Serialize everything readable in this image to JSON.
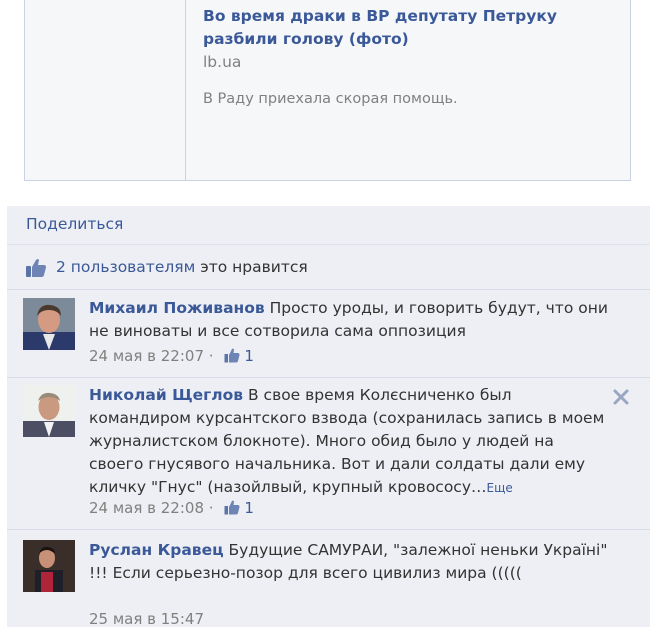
{
  "share_preview": {
    "title": "Во время драки в ВР депутату Петруку разбили голову (фото)",
    "domain": "lb.ua",
    "description": "В Раду приехала скорая помощь."
  },
  "feedback": {
    "share_label": "Поделиться",
    "likes_link": "2 пользователям",
    "likes_suffix": " это нравится"
  },
  "comments": [
    {
      "author": "Михаил Поживанов",
      "text": "Просто уроды, и говорить будут, что они не виноваты и все сотворила сама оппозиция",
      "time": "24 мая в 22:07",
      "likes": "1"
    },
    {
      "author": "Николай Щеглов",
      "text": "В свое время Колєсниченко был командиром курсантского взвода (сохранилась запись в моем журналистском блокноте). Много обид было у людей на своего гнусявого начальника. Вот и дали солдаты дали ему кличку \"Гнус\" (назойлвый, крупный кровососу…",
      "more": "Еще",
      "time": "24 мая в 22:08",
      "likes": "1"
    },
    {
      "author": "Руслан Кравец",
      "text": "Будущие САМУРАИ, \"залежної неньки Україні\" !!! Если серьезно-позор для всего цивилиз мира (((((",
      "time": "25 мая в 15:47"
    }
  ],
  "colors": {
    "link": "#3b5998",
    "muted": "#808080",
    "panel": "#edeff4"
  },
  "icons": [
    "thumbs-up-icon",
    "close-icon"
  ]
}
